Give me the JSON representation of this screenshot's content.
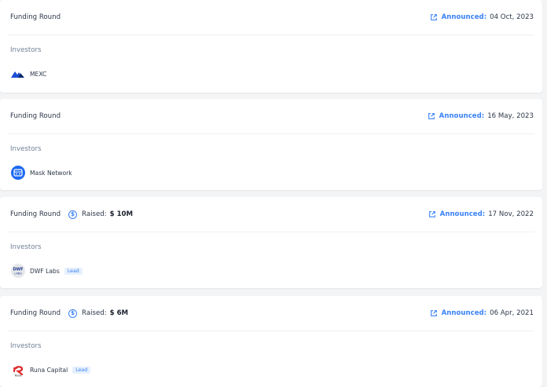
{
  "rounds": [
    {
      "round_label": "Funding Round",
      "raised": null,
      "announced_label": "Announced:",
      "announced_date": "04 Oct, 2023",
      "investors_title": "Investors",
      "investor": {
        "name": "MEXC",
        "logo": "mexc-logo",
        "lead": null
      }
    },
    {
      "round_label": "Funding Round",
      "raised": null,
      "announced_label": "Announced:",
      "announced_date": "16 May, 2023",
      "investors_title": "Investors",
      "investor": {
        "name": "Mask Network",
        "logo": "mask-network-logo",
        "lead": null
      }
    },
    {
      "round_label": "Funding Round",
      "raised": {
        "label": "Raised:",
        "amount": "$ 10M"
      },
      "announced_label": "Announced:",
      "announced_date": "17 Nov, 2022",
      "investors_title": "Investors",
      "investor": {
        "name": "DWF Labs",
        "logo": "dwf-labs-logo",
        "lead": "Lead"
      }
    },
    {
      "round_label": "Funding Round",
      "raised": {
        "label": "Raised:",
        "amount": "$ 6M"
      },
      "announced_label": "Announced:",
      "announced_date": "06 Apr, 2021",
      "investors_title": "Investors",
      "investor": {
        "name": "Runa Capital",
        "logo": "runa-capital-logo",
        "lead": "Lead"
      }
    }
  ],
  "colors": {
    "accent": "#3b82f6",
    "text": "#2d3748",
    "muted": "#718096",
    "lead_bg": "#e6f0fd"
  },
  "icons": {
    "raised": "dollar-circle-icon",
    "announced": "external-link-icon"
  },
  "logo_text": {
    "dwf": "DWF\nLABS",
    "runa": "Runa"
  }
}
